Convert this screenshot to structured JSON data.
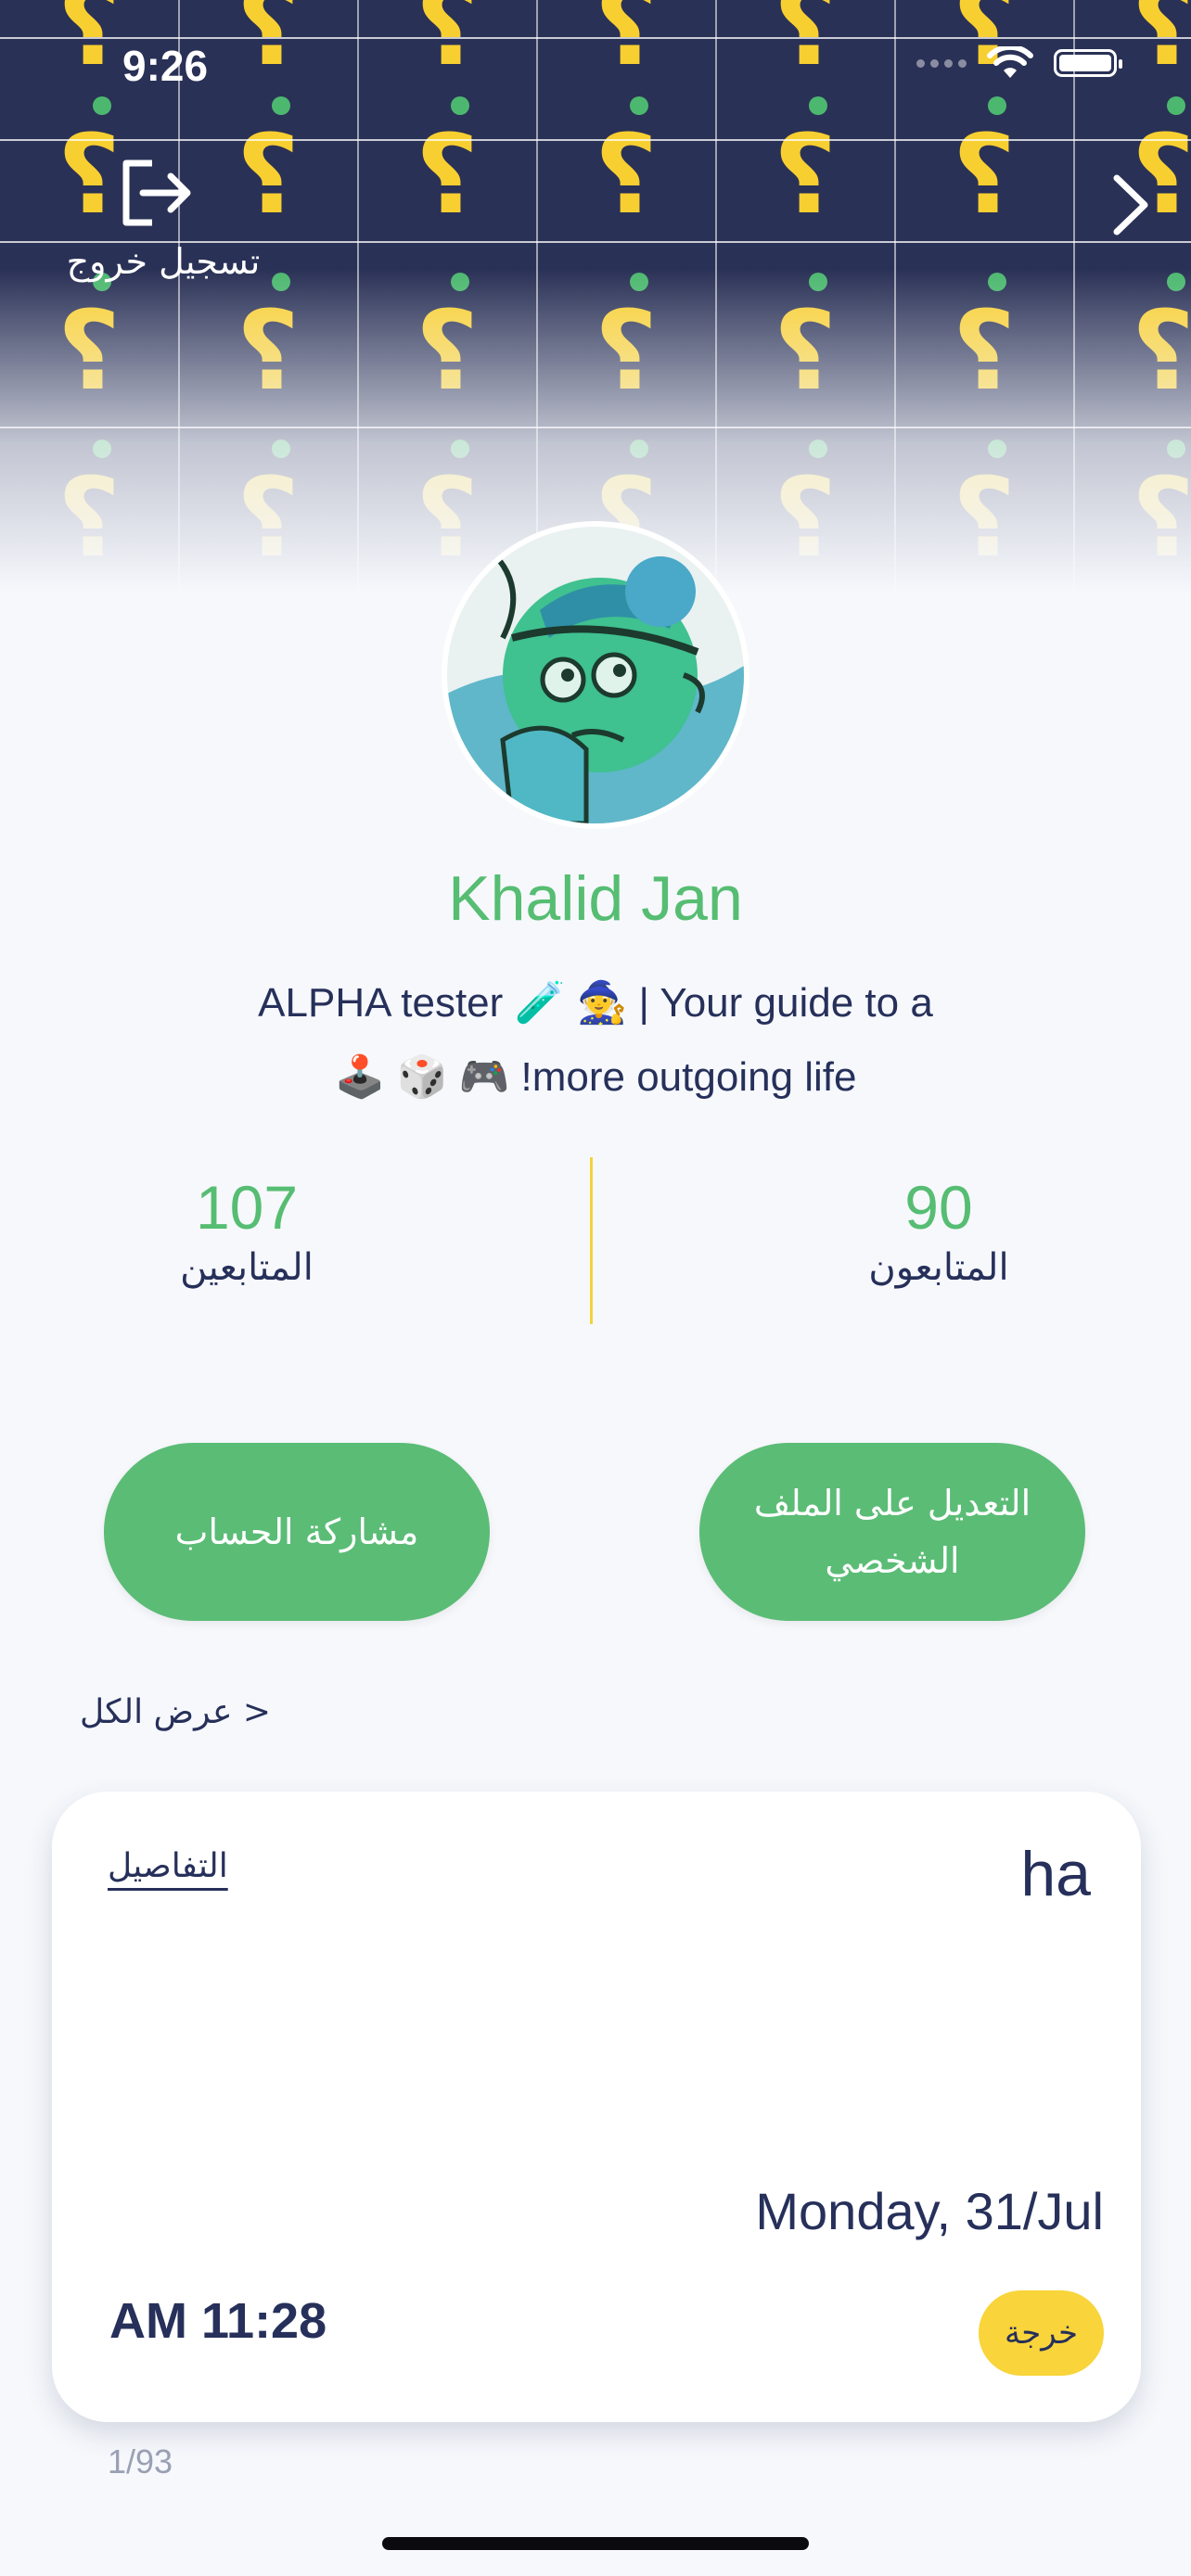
{
  "status_bar": {
    "time": "9:26"
  },
  "header": {
    "logout_label": "تسجيل خروج",
    "pattern_colors": {
      "background": "#2a3156",
      "glyph": "#f8cf31",
      "dot": "#4cb86f"
    }
  },
  "profile": {
    "name": "Khalid Jan",
    "bio_line1": "ALPHA tester 🧪 🧙  | Your guide to a",
    "bio_line2": "🕹️ 🎲 🎮  !more outgoing life"
  },
  "stats": {
    "left": {
      "value": "107",
      "label": "المتابعين"
    },
    "right": {
      "value": "90",
      "label": "المتابعون"
    }
  },
  "actions": {
    "share_label": "مشاركة الحساب",
    "edit_label_line1": "التعديل على الملف",
    "edit_label_line2": "الشخصي"
  },
  "section": {
    "view_all": "عرض الكل >"
  },
  "card": {
    "title": "ha",
    "details_link": "التفاصيل",
    "date": "Monday, 31/Jul",
    "time": "AM 11:28",
    "badge": "خرجة"
  },
  "pager": {
    "counter": "1/93"
  },
  "colors": {
    "accent_green": "#5bbc76",
    "accent_yellow": "#f9d43a",
    "text_dark": "#26305a"
  }
}
